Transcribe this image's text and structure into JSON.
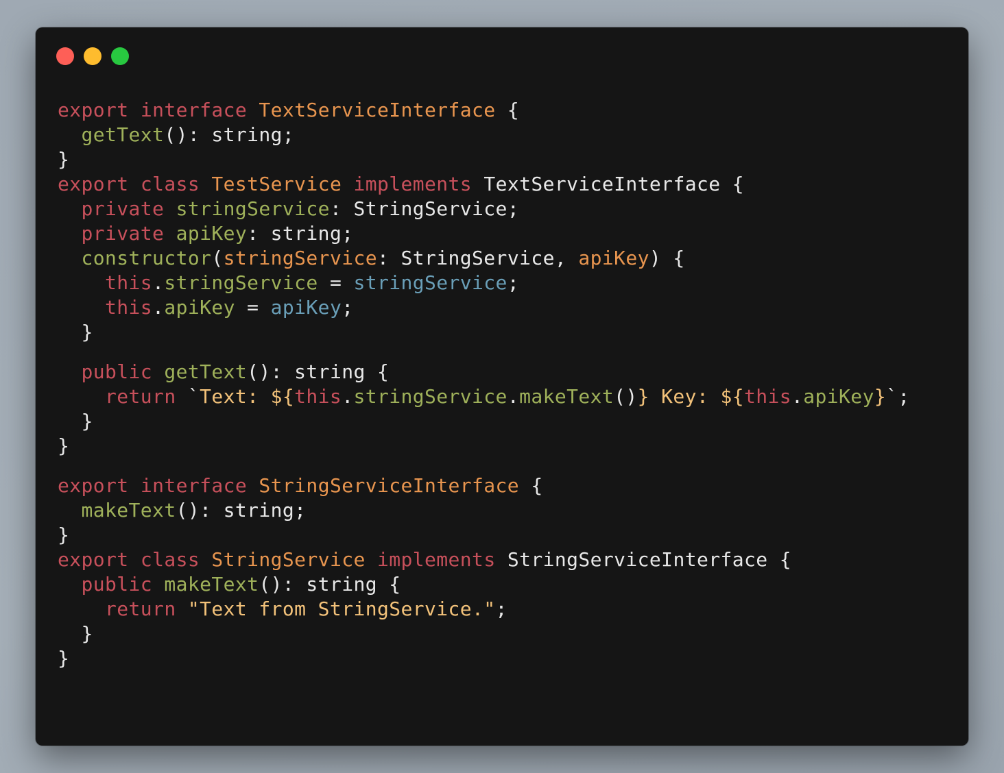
{
  "window": {
    "controls": {
      "close_color": "#fe5f57",
      "minimize_color": "#febc2e",
      "maximize_color": "#28c840"
    }
  },
  "code": {
    "language": "typescript",
    "lines": [
      [
        {
          "t": "export",
          "c": "k"
        },
        {
          "t": " "
        },
        {
          "t": "interface",
          "c": "k"
        },
        {
          "t": " "
        },
        {
          "t": "TextServiceInterface",
          "c": "t"
        },
        {
          "t": " {"
        }
      ],
      [
        {
          "t": "  "
        },
        {
          "t": "getText",
          "c": "f"
        },
        {
          "t": "(): string;"
        }
      ],
      [
        {
          "t": "}"
        }
      ],
      [
        {
          "t": "export",
          "c": "k"
        },
        {
          "t": " "
        },
        {
          "t": "class",
          "c": "k"
        },
        {
          "t": " "
        },
        {
          "t": "TestService",
          "c": "t"
        },
        {
          "t": " "
        },
        {
          "t": "implements",
          "c": "k"
        },
        {
          "t": " TextServiceInterface {"
        }
      ],
      [
        {
          "t": "  "
        },
        {
          "t": "private",
          "c": "k"
        },
        {
          "t": " "
        },
        {
          "t": "stringService",
          "c": "f"
        },
        {
          "t": ": StringService;"
        }
      ],
      [
        {
          "t": "  "
        },
        {
          "t": "private",
          "c": "k"
        },
        {
          "t": " "
        },
        {
          "t": "apiKey",
          "c": "f"
        },
        {
          "t": ": string;"
        }
      ],
      [
        {
          "t": "  "
        },
        {
          "t": "constructor",
          "c": "f"
        },
        {
          "t": "("
        },
        {
          "t": "stringService",
          "c": "t"
        },
        {
          "t": ": StringService, "
        },
        {
          "t": "apiKey",
          "c": "t"
        },
        {
          "t": ") {"
        }
      ],
      [
        {
          "t": "    "
        },
        {
          "t": "this",
          "c": "k"
        },
        {
          "t": "."
        },
        {
          "t": "stringService",
          "c": "f"
        },
        {
          "t": " = "
        },
        {
          "t": "stringService",
          "c": "v"
        },
        {
          "t": ";"
        }
      ],
      [
        {
          "t": "    "
        },
        {
          "t": "this",
          "c": "k"
        },
        {
          "t": "."
        },
        {
          "t": "apiKey",
          "c": "f"
        },
        {
          "t": " = "
        },
        {
          "t": "apiKey",
          "c": "v"
        },
        {
          "t": ";"
        }
      ],
      [
        {
          "t": "  }"
        }
      ],
      [],
      [
        {
          "t": "  "
        },
        {
          "t": "public",
          "c": "k"
        },
        {
          "t": " "
        },
        {
          "t": "getText",
          "c": "f"
        },
        {
          "t": "(): string {"
        }
      ],
      [
        {
          "t": "    "
        },
        {
          "t": "return",
          "c": "k"
        },
        {
          "t": " `",
          "c": "p"
        },
        {
          "t": "Text: ${",
          "c": "s"
        },
        {
          "t": "this",
          "c": "k"
        },
        {
          "t": "."
        },
        {
          "t": "stringService",
          "c": "f"
        },
        {
          "t": "."
        },
        {
          "t": "makeText",
          "c": "f"
        },
        {
          "t": "()"
        },
        {
          "t": "} Key: ${",
          "c": "s"
        },
        {
          "t": "this",
          "c": "k"
        },
        {
          "t": "."
        },
        {
          "t": "apiKey",
          "c": "f"
        },
        {
          "t": "}",
          "c": "s"
        },
        {
          "t": "`;"
        }
      ],
      [
        {
          "t": "  }"
        }
      ],
      [
        {
          "t": "}"
        }
      ],
      [],
      [
        {
          "t": "export",
          "c": "k"
        },
        {
          "t": " "
        },
        {
          "t": "interface",
          "c": "k"
        },
        {
          "t": " "
        },
        {
          "t": "StringServiceInterface",
          "c": "t"
        },
        {
          "t": " {"
        }
      ],
      [
        {
          "t": "  "
        },
        {
          "t": "makeText",
          "c": "f"
        },
        {
          "t": "(): string;"
        }
      ],
      [
        {
          "t": "}"
        }
      ],
      [
        {
          "t": "export",
          "c": "k"
        },
        {
          "t": " "
        },
        {
          "t": "class",
          "c": "k"
        },
        {
          "t": " "
        },
        {
          "t": "StringService",
          "c": "t"
        },
        {
          "t": " "
        },
        {
          "t": "implements",
          "c": "k"
        },
        {
          "t": " StringServiceInterface {"
        }
      ],
      [
        {
          "t": "  "
        },
        {
          "t": "public",
          "c": "k"
        },
        {
          "t": " "
        },
        {
          "t": "makeText",
          "c": "f"
        },
        {
          "t": "(): string {"
        }
      ],
      [
        {
          "t": "    "
        },
        {
          "t": "return",
          "c": "k"
        },
        {
          "t": " "
        },
        {
          "t": "\"Text from StringService.\"",
          "c": "s"
        },
        {
          "t": ";"
        }
      ],
      [
        {
          "t": "  }"
        }
      ],
      [
        {
          "t": "}"
        }
      ]
    ]
  }
}
